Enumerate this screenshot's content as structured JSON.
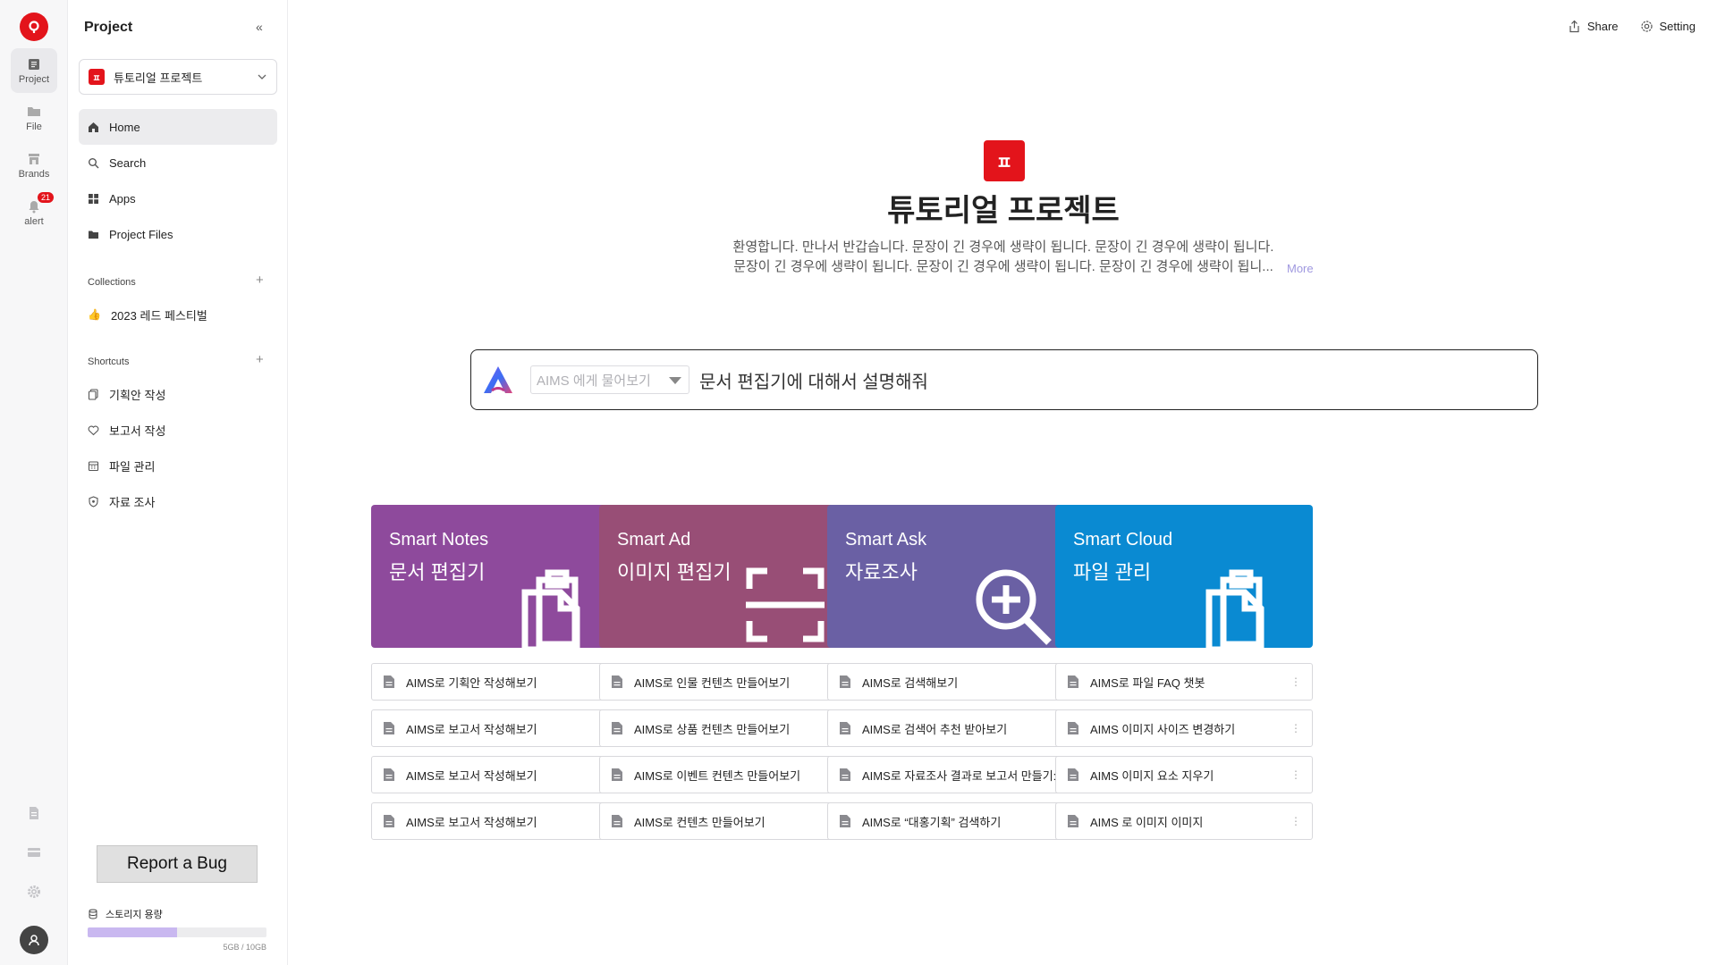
{
  "rail": {
    "items": [
      {
        "label": "Project",
        "icon": "project-icon"
      },
      {
        "label": "File",
        "icon": "folder-icon"
      },
      {
        "label": "Brands",
        "icon": "store-icon"
      },
      {
        "label": "alert",
        "icon": "bell-icon",
        "badge": "21"
      }
    ],
    "bottom_icons": [
      "document-icon",
      "card-icon",
      "gear-icon"
    ],
    "brand_color": "#e3141b"
  },
  "sidebar": {
    "title": "Project",
    "project_select": "튜토리얼 프로젝트",
    "nav": [
      {
        "label": "Home",
        "icon": "home-icon"
      },
      {
        "label": "Search",
        "icon": "search-icon"
      },
      {
        "label": "Apps",
        "icon": "grid-icon"
      },
      {
        "label": "Project Files",
        "icon": "folder-icon"
      }
    ],
    "collections_label": "Collections",
    "collections": [
      {
        "label": "2023 레드 페스티벌",
        "icon": "thumbs-up-icon"
      }
    ],
    "shortcuts_label": "Shortcuts",
    "shortcuts": [
      {
        "label": "기획안 작성",
        "icon": "copy-icon"
      },
      {
        "label": "보고서 작성",
        "icon": "heart-icon"
      },
      {
        "label": "파일 관리",
        "icon": "calendar-icon"
      },
      {
        "label": "자료 조사",
        "icon": "shield-icon"
      }
    ],
    "report_bug": "Report a Bug",
    "storage_label": "스토리지 용량",
    "storage_text": "5GB / 10GB",
    "storage_fraction": 0.5
  },
  "topbar": {
    "share": "Share",
    "setting": "Setting"
  },
  "hero": {
    "title": "튜토리얼 프로젝트",
    "desc_line1": "환영합니다. 만나서 반갑습니다. 문장이 긴 경우에 생략이 됩니다. 문장이 긴 경우에 생략이 됩니다.",
    "desc_line2": "문장이 긴 경우에 생략이 됩니다. 문장이 긴 경우에 생략이 됩니다. 문장이 긴 경우에 생략이 됩니...",
    "more": "More"
  },
  "ask": {
    "select_placeholder": "AIMS 에게 물어보기",
    "input_value": "문서 편집기에 대해서 설명해줘"
  },
  "cards": [
    {
      "title": "Smart Notes",
      "subtitle": "문서 편집기",
      "color": "#8e4a9c",
      "icon": "clipboard-icon",
      "items": [
        "AIMS로 기획안 작성해보기",
        "AIMS로 보고서 작성해보기",
        "AIMS로 보고서 작성해보기",
        "AIMS로 보고서 작성해보기"
      ]
    },
    {
      "title": "Smart Ad",
      "subtitle": "이미지 편집기",
      "color": "#984e76",
      "icon": "scan-frame-icon",
      "items": [
        "AIMS로 인물 컨텐츠 만들어보기",
        "AIMS로 상품 컨텐츠 만들어보기",
        "AIMS로 이벤트 컨텐츠 만들어보기",
        "AIMS로 컨텐츠 만들어보기"
      ]
    },
    {
      "title": "Smart Ask",
      "subtitle": "자료조사",
      "color": "#6a60a4",
      "icon": "zoom-in-icon",
      "items": [
        "AIMS로 검색해보기",
        "AIMS로 검색어 추천 받아보기",
        "AIMS로 자료조사 결과로 보고서 만들기:",
        "AIMS로 “대홍기획” 검색하기"
      ]
    },
    {
      "title": "Smart Cloud",
      "subtitle": "파일 관리",
      "color": "#0a8ad2",
      "icon": "clipboard-icon",
      "items": [
        "AIMS로 파일 FAQ 챗봇",
        "AIMS 이미지 사이즈 변경하기",
        "AIMS 이미지 요소 지우기",
        "AIMS 로 이미지 이미지"
      ]
    }
  ]
}
